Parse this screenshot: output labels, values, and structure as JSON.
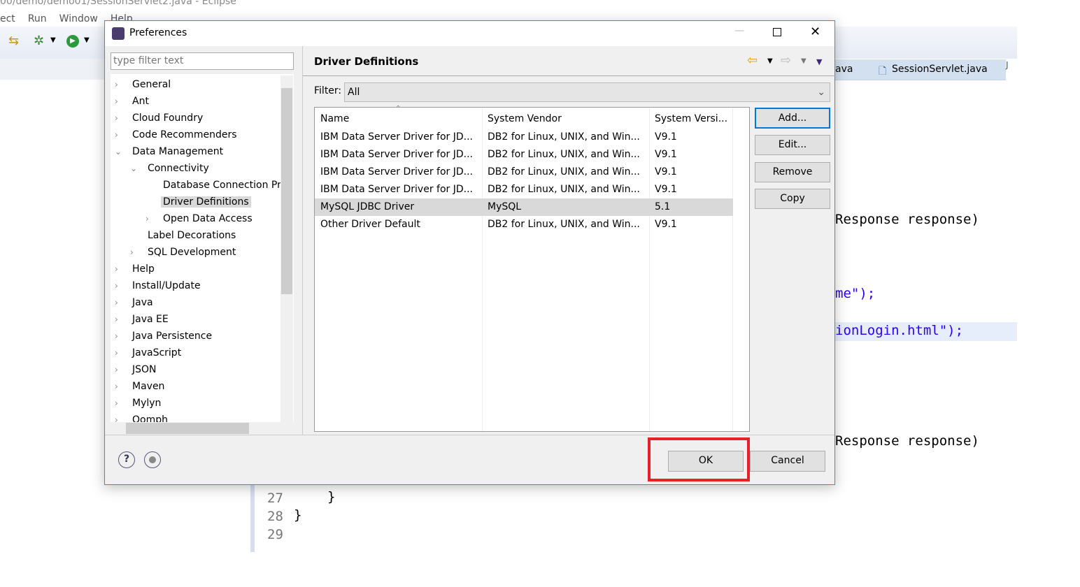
{
  "window": {
    "title": "00/demo/demo01/SessionServlet2.java - Eclipse",
    "menu": [
      "ect",
      "Run",
      "Window",
      "Help"
    ]
  },
  "editor": {
    "tabs": [
      "ava",
      "SessionServlet.java",
      "J"
    ],
    "code_lines": [
      {
        "text": "Response response)",
        "y": "esponse"
      },
      {
        "text": "me\");"
      },
      {
        "text": "ionLogin.html\");"
      },
      {
        "text": "Response response)"
      }
    ],
    "line_numbers": [
      "27",
      "28",
      "29"
    ],
    "bottom_code": [
      "}",
      "}"
    ]
  },
  "dialog": {
    "title": "Preferences",
    "filter_placeholder": "type filter text",
    "tree": [
      {
        "label": "General",
        "level": 0,
        "chev": "›"
      },
      {
        "label": "Ant",
        "level": 0,
        "chev": "›"
      },
      {
        "label": "Cloud Foundry",
        "level": 0,
        "chev": "›"
      },
      {
        "label": "Code Recommenders",
        "level": 0,
        "chev": "›"
      },
      {
        "label": "Data Management",
        "level": 0,
        "chev": "⌄"
      },
      {
        "label": "Connectivity",
        "level": 1,
        "chev": "⌄"
      },
      {
        "label": "Database Connection Pr",
        "level": 2,
        "chev": ""
      },
      {
        "label": "Driver Definitions",
        "level": 2,
        "chev": "",
        "selected": true
      },
      {
        "label": "Open Data Access",
        "level": 2,
        "chev": "›"
      },
      {
        "label": "Label Decorations",
        "level": 1,
        "chev": ""
      },
      {
        "label": "SQL Development",
        "level": 1,
        "chev": "›"
      },
      {
        "label": "Help",
        "level": 0,
        "chev": "›"
      },
      {
        "label": "Install/Update",
        "level": 0,
        "chev": "›"
      },
      {
        "label": "Java",
        "level": 0,
        "chev": "›"
      },
      {
        "label": "Java EE",
        "level": 0,
        "chev": "›"
      },
      {
        "label": "Java Persistence",
        "level": 0,
        "chev": "›"
      },
      {
        "label": "JavaScript",
        "level": 0,
        "chev": "›"
      },
      {
        "label": "JSON",
        "level": 0,
        "chev": "›"
      },
      {
        "label": "Maven",
        "level": 0,
        "chev": "›"
      },
      {
        "label": "Mylyn",
        "level": 0,
        "chev": "›"
      },
      {
        "label": "Oomph",
        "level": 0,
        "chev": "›"
      }
    ],
    "page_title": "Driver Definitions",
    "filter_label": "Filter:",
    "filter_value": "All",
    "columns": [
      "Name",
      "System Vendor",
      "System Versi..."
    ],
    "rows": [
      [
        "IBM Data Server Driver for JD...",
        "DB2 for Linux, UNIX, and Win...",
        "V9.1"
      ],
      [
        "IBM Data Server Driver for JD...",
        "DB2 for Linux, UNIX, and Win...",
        "V9.1"
      ],
      [
        "IBM Data Server Driver for JD...",
        "DB2 for Linux, UNIX, and Win...",
        "V9.1"
      ],
      [
        "IBM Data Server Driver for JD...",
        "DB2 for Linux, UNIX, and Win...",
        "V9.1"
      ],
      [
        "MySQL JDBC Driver",
        "MySQL",
        "5.1"
      ],
      [
        "Other Driver Default",
        "DB2 for Linux, UNIX, and Win...",
        "V9.1"
      ]
    ],
    "selected_row": 4,
    "buttons": {
      "add": "Add...",
      "edit": "Edit...",
      "remove": "Remove",
      "copy": "Copy",
      "ok": "OK",
      "cancel": "Cancel"
    },
    "highlight_color": "#e8202a"
  }
}
